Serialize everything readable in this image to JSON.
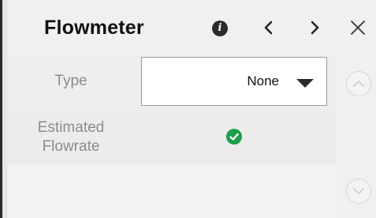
{
  "panel": {
    "title": "Flowmeter",
    "icons": {
      "info": "info-icon",
      "prev": "chevron-left-icon",
      "next": "chevron-right-icon",
      "close": "close-icon",
      "scroll_up": "chevron-up-icon",
      "scroll_down": "chevron-down-icon",
      "status": "check-circle-icon"
    }
  },
  "fields": {
    "type": {
      "label": "Type",
      "value": "None"
    },
    "estimated_flowrate": {
      "label_line1": "Estimated",
      "label_line2": "Flowrate",
      "checked": true
    }
  },
  "colors": {
    "check_green": "#1e9d4a",
    "label_gray": "#8c8c8c"
  }
}
